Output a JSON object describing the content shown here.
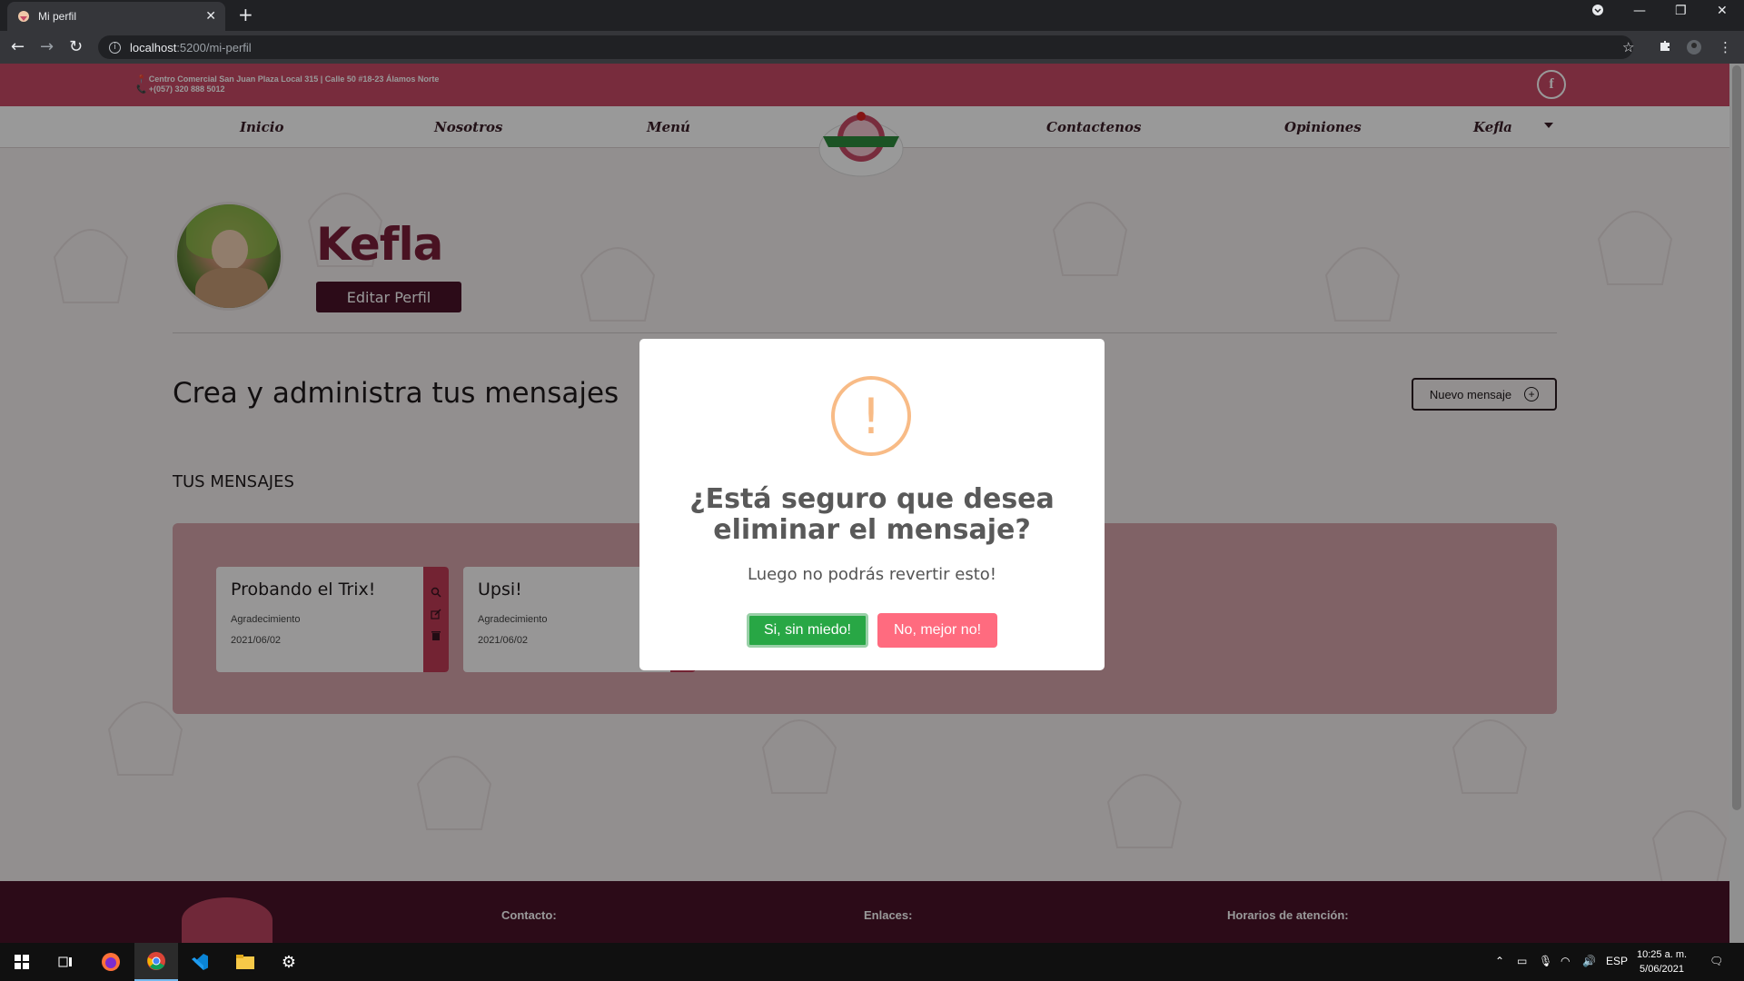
{
  "browser": {
    "tab_title": "Mi perfil",
    "url_host": "localhost",
    "url_path": ":5200/mi-perfil"
  },
  "site": {
    "topbar": {
      "address": "Centro Comercial San Juan Plaza Local 315 | Calle 50 #18-23 Álamos Norte",
      "phone": "+(057) 320 888 5012"
    },
    "nav": {
      "inicio": "Inicio",
      "nosotros": "Nosotros",
      "menu": "Menú",
      "contactenos": "Contactenos",
      "opiniones": "Opiniones",
      "user": "Kefla"
    },
    "profile": {
      "name": "Kefla",
      "edit_button": "Editar Perfil"
    },
    "messages": {
      "section_title": "Crea y administra tus mensajes",
      "new_button": "Nuevo mensaje",
      "heading": "TUS MENSAJES",
      "items": [
        {
          "title": "Probando el Trix!",
          "category": "Agradecimiento",
          "date": "2021/06/02"
        },
        {
          "title": "Upsi!",
          "category": "Agradecimiento",
          "date": "2021/06/02"
        }
      ]
    },
    "footer": {
      "contacto": "Contacto:",
      "enlaces": "Enlaces:",
      "horarios": "Horarios de atención:"
    }
  },
  "modal": {
    "icon": "!",
    "title": "¿Está seguro que desea eliminar el mensaje?",
    "text": "Luego no podrás revertir esto!",
    "confirm": "Si, sin miedo!",
    "cancel": "No, mejor no!"
  },
  "taskbar": {
    "lang": "ESP",
    "time": "10:25 a. m.",
    "date": "5/06/2021"
  },
  "colors": {
    "brand": "#c84a66",
    "dark": "#4a1328",
    "confirm": "#28a745",
    "cancel": "#ff6b7f",
    "warning": "#f8bb86"
  }
}
